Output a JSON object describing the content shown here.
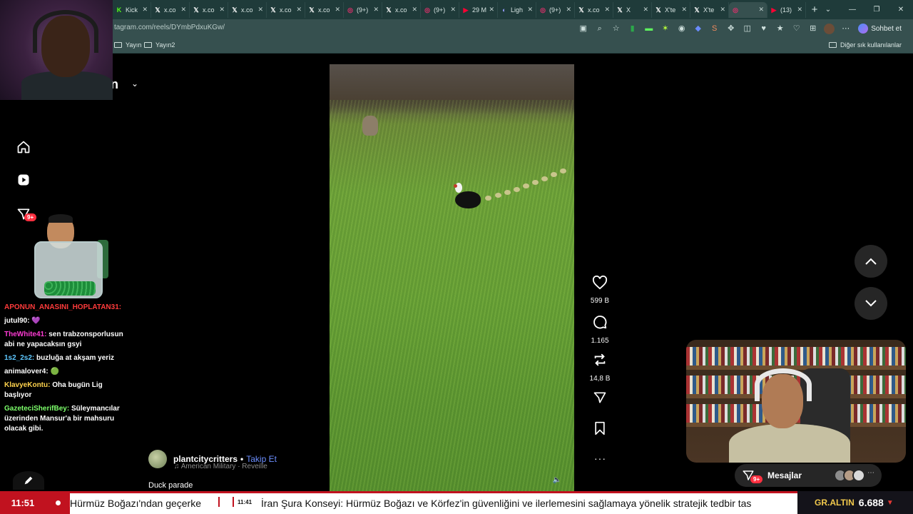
{
  "browser": {
    "tabs": [
      {
        "label": "Kick",
        "icon": "kick-icon",
        "color": "#53fc18"
      },
      {
        "label": "x.co",
        "icon": "x-icon",
        "color": "#ffffff"
      },
      {
        "label": "x.co",
        "icon": "x-icon",
        "color": "#ffffff"
      },
      {
        "label": "x.co",
        "icon": "x-icon",
        "color": "#ffffff"
      },
      {
        "label": "x.co",
        "icon": "x-icon",
        "color": "#ffffff"
      },
      {
        "label": "x.co",
        "icon": "x-icon",
        "color": "#ffffff"
      },
      {
        "label": "(9+)",
        "icon": "instagram-icon",
        "color": "#e1306c"
      },
      {
        "label": "x.co",
        "icon": "x-icon",
        "color": "#ffffff"
      },
      {
        "label": "(9+)",
        "icon": "instagram-icon",
        "color": "#e1306c"
      },
      {
        "label": "29 M",
        "icon": "youtube-icon",
        "color": "#ff0033"
      },
      {
        "label": "Ligh",
        "icon": "light-icon",
        "color": "#9aa0ff"
      },
      {
        "label": "(9+)",
        "icon": "instagram-icon",
        "color": "#e1306c"
      },
      {
        "label": "x.co",
        "icon": "x-icon",
        "color": "#ffffff"
      },
      {
        "label": "X",
        "icon": "x-icon",
        "color": "#ffffff"
      },
      {
        "label": "X'te",
        "icon": "x-icon",
        "color": "#ffffff"
      },
      {
        "label": "X'te",
        "icon": "x-icon",
        "color": "#ffffff"
      },
      {
        "label": "",
        "icon": "instagram-icon",
        "color": "#e1306c",
        "active": true
      },
      {
        "label": "(13)",
        "icon": "youtube-icon",
        "color": "#ff0033"
      }
    ],
    "url": "tagram.com/reels/DYmbPdxuKGw/",
    "bookmarks": [
      "Yayın",
      "Yayın2"
    ],
    "other_bookmarks": "Diğer sık kullanılanlar",
    "copilot_label": "Sohbet et"
  },
  "account": {
    "name_fragment": "in"
  },
  "sidebar": {
    "notification_badge": "9+"
  },
  "reel": {
    "likes": "599 B",
    "comments": "1.165",
    "reposts": "14,8 B",
    "author": "plantcitycritters",
    "separator": "•",
    "follow_label": "Takip Et",
    "audio": "American Military · Reveille",
    "caption": "Duck parade"
  },
  "messages": {
    "label": "Mesajlar",
    "badge": "9+"
  },
  "chat": [
    {
      "user": "APONUN_ANASINI_HOPLATAN31:",
      "user_color": "#ff3b3b",
      "text": ""
    },
    {
      "user": "jutul90:",
      "user_color": "#ffffff",
      "text": "💜"
    },
    {
      "user": "TheWhite41:",
      "user_color": "#ff3bd4",
      "text": "sen trabzonsporlusun abi ne yapacaksın gsyi"
    },
    {
      "user": "1s2_2s2:",
      "user_color": "#5ec8ff",
      "text": "buzluğa at akşam yeriz"
    },
    {
      "user": "animalover4:",
      "user_color": "#ffffff",
      "text": "🟢"
    },
    {
      "user": "KlavyeKontu:",
      "user_color": "#ffd34d",
      "text": "Oha bugün Lig başlıyor"
    },
    {
      "user": "GazeteciSherifBey:",
      "user_color": "#7dff6b",
      "text": "Süleymancılar üzerinden Mansur'a bir mahsuru olacak gibi."
    }
  ],
  "ticker": {
    "clock": "11:51",
    "item1": "Hürmüz Boğazı'ndan geçerke",
    "item2_time": "11:41",
    "item2": "İran Şura Konseyi: Hürmüz Boğazı ve Körfez'in güvenliğini ve ilerlemesini sağlamaya yönelik stratejik tedbir tas",
    "gold_label": "GR.ALTIN",
    "gold_value": "6.688",
    "gold_trend": "▼"
  }
}
